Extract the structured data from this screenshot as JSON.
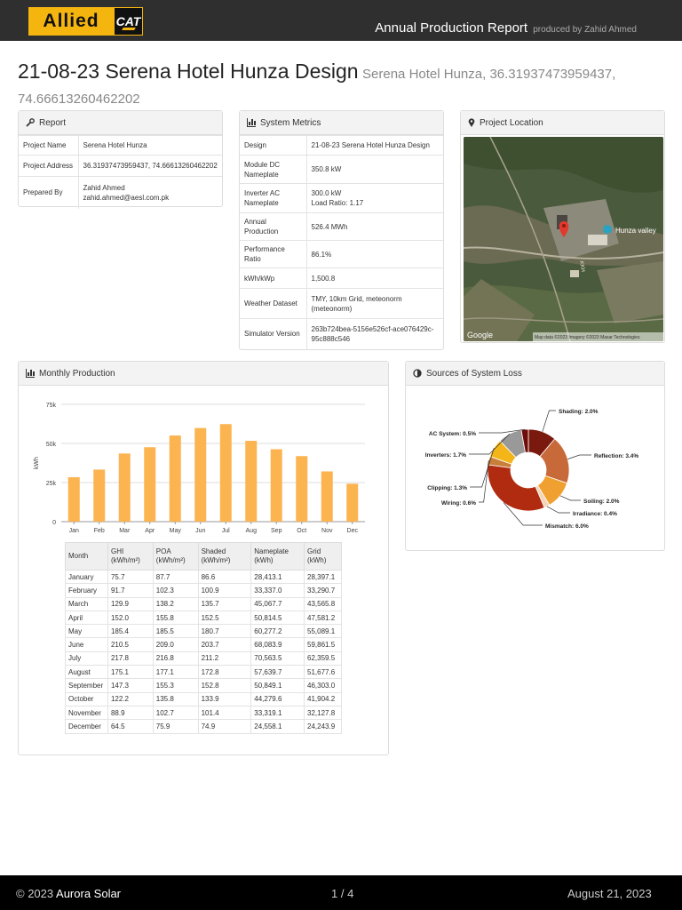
{
  "header": {
    "logo_text": "Allied",
    "logo_mark": "CAT",
    "report_title": "Annual Production Report",
    "produced_by": "produced by Zahid Ahmed"
  },
  "title": {
    "main": "21-08-23 Serena Hotel Hunza Design",
    "sub": "Serena Hotel Hunza, 36.31937473959437, 74.66613260462202"
  },
  "report": {
    "heading": "Report",
    "rows": [
      {
        "label": "Project Name",
        "value": "Serena Hotel Hunza"
      },
      {
        "label": "Project Address",
        "value": "36.31937473959437, 74.66613260462202"
      },
      {
        "label": "Prepared By",
        "value": "Zahid Ahmed",
        "value2": "zahid.ahmed@aesl.com.pk"
      }
    ]
  },
  "metrics": {
    "heading": "System Metrics",
    "rows": [
      {
        "label": "Design",
        "value": "21-08-23 Serena Hotel Hunza Design"
      },
      {
        "label": "Module DC Nameplate",
        "value": "350.8 kW"
      },
      {
        "label": "Inverter AC Nameplate",
        "value": "300.0 kW",
        "value2": "Load Ratio: 1.17"
      },
      {
        "label": "Annual Production",
        "value": "526.4 MWh"
      },
      {
        "label": "Performance Ratio",
        "value": "86.1%"
      },
      {
        "label": "kWh/kWp",
        "value": "1,500.8"
      },
      {
        "label": "Weather Dataset",
        "value": "TMY, 10km Grid, meteonorm (meteonorm)"
      },
      {
        "label": "Simulator Version",
        "value": "263b724bea-5156e526cf-ace076429c-95c888c546"
      }
    ]
  },
  "location": {
    "heading": "Project Location",
    "place_label": "Hunza valley",
    "road_label": "KKH",
    "attribution": "Map data ©2023 Imagery ©2023 Maxar Technologies",
    "google": "Google"
  },
  "monthly": {
    "heading": "Monthly Production",
    "columns": [
      "Month",
      "GHI (kWh/m²)",
      "POA (kWh/m²)",
      "Shaded (kWh/m²)",
      "Nameplate (kWh)",
      "Grid (kWh)"
    ],
    "rows": [
      [
        "January",
        "75.7",
        "87.7",
        "86.6",
        "28,413.1",
        "28,397.1"
      ],
      [
        "February",
        "91.7",
        "102.3",
        "100.9",
        "33,337.0",
        "33,290.7"
      ],
      [
        "March",
        "129.9",
        "138.2",
        "135.7",
        "45,067.7",
        "43,565.8"
      ],
      [
        "April",
        "152.0",
        "155.8",
        "152.5",
        "50,814.5",
        "47,581.2"
      ],
      [
        "May",
        "185.4",
        "185.5",
        "180.7",
        "60,277.2",
        "55,089.1"
      ],
      [
        "June",
        "210.5",
        "209.0",
        "203.7",
        "68,083.9",
        "59,861.5"
      ],
      [
        "July",
        "217.8",
        "216.8",
        "211.2",
        "70,563.5",
        "62,359.5"
      ],
      [
        "August",
        "175.1",
        "177.1",
        "172.8",
        "57,639.7",
        "51,677.6"
      ],
      [
        "September",
        "147.3",
        "155.3",
        "152.8",
        "50,849.1",
        "46,303.0"
      ],
      [
        "October",
        "122.2",
        "135.8",
        "133.9",
        "44,279.6",
        "41,904.2"
      ],
      [
        "November",
        "88.9",
        "102.7",
        "101.4",
        "33,319.1",
        "32,127.8"
      ],
      [
        "December",
        "64.5",
        "75.9",
        "74.9",
        "24,558.1",
        "24,243.9"
      ]
    ]
  },
  "losses": {
    "heading": "Sources of System Loss"
  },
  "chart_data": [
    {
      "type": "bar",
      "title": "",
      "ylabel": "kWh",
      "categories": [
        "Jan",
        "Feb",
        "Mar",
        "Apr",
        "May",
        "Jun",
        "Jul",
        "Aug",
        "Sep",
        "Oct",
        "Nov",
        "Dec"
      ],
      "values": [
        28397.1,
        33290.7,
        43565.8,
        47581.2,
        55089.1,
        59861.5,
        62359.5,
        51677.6,
        46303.0,
        41904.2,
        32127.8,
        24243.9
      ],
      "yticks": [
        "0",
        "25k",
        "50k",
        "75k"
      ],
      "ylim": [
        0,
        75000
      ],
      "grid": true,
      "color": "#fbb450"
    },
    {
      "type": "pie",
      "slices": [
        {
          "label": "Shading: 2.0%",
          "value": 2.0,
          "color": "#7a1a0e"
        },
        {
          "label": "Reflection: 3.4%",
          "value": 3.4,
          "color": "#c8693a"
        },
        {
          "label": "Soiling: 2.0%",
          "value": 2.0,
          "color": "#f0a030"
        },
        {
          "label": "Irradiance: 0.4%",
          "value": 0.4,
          "color": "#f3d6b8"
        },
        {
          "label": "Mismatch: 6.0%",
          "value": 6.0,
          "color": "#b02b10"
        },
        {
          "label": "Wiring: 0.6%",
          "value": 0.6,
          "color": "#c97f3a"
        },
        {
          "label": "Clipping: 1.3%",
          "value": 1.3,
          "color": "#f4b518"
        },
        {
          "label": "Inverters: 1.7%",
          "value": 1.7,
          "color": "#999999"
        },
        {
          "label": "AC System: 0.5%",
          "value": 0.5,
          "color": "#6e0d0a"
        }
      ]
    }
  ],
  "footer": {
    "copyright": "© 2023",
    "company": "Aurora Solar",
    "page": "1 / 4",
    "date": "August 21, 2023"
  }
}
